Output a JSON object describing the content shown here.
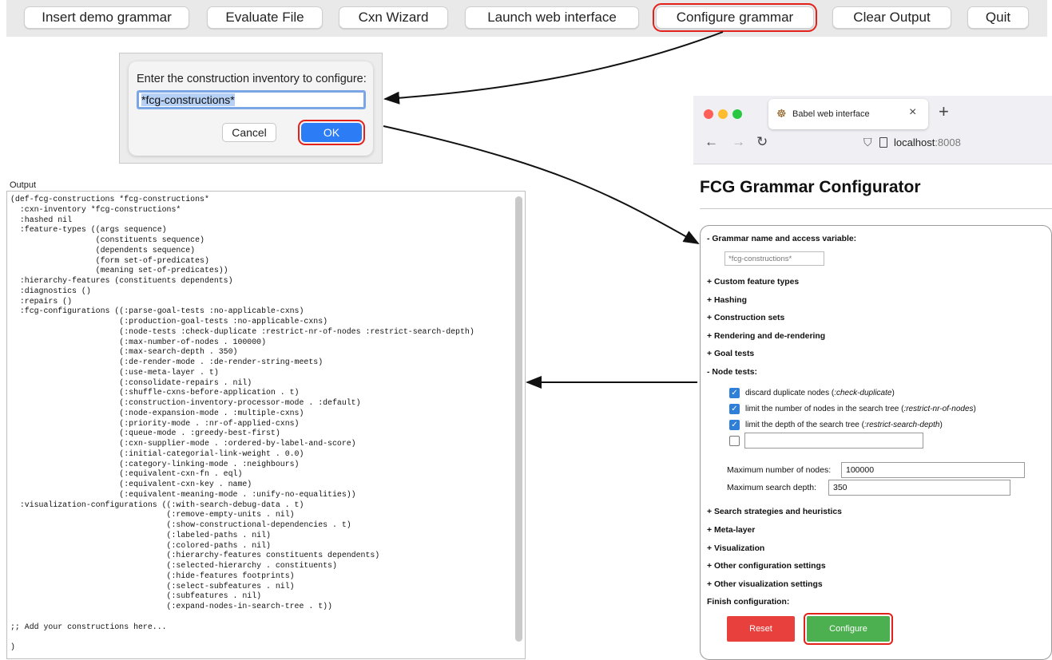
{
  "toolbar": {
    "insert_demo": "Insert demo grammar",
    "evaluate_file": "Evaluate File",
    "cxn_wizard": "Cxn Wizard",
    "launch_web": "Launch web interface",
    "configure": "Configure grammar",
    "clear_output": "Clear Output",
    "quit": "Quit"
  },
  "dialog": {
    "prompt": "Enter the construction inventory to configure:",
    "value": "*fcg-constructions*",
    "cancel": "Cancel",
    "ok": "OK"
  },
  "output": {
    "title": "Output",
    "lines": [
      "(def-fcg-constructions *fcg-constructions*",
      "  :cxn-inventory *fcg-constructions*",
      "  :hashed nil",
      "  :feature-types ((args sequence)",
      "                  (constituents sequence)",
      "                  (dependents sequence)",
      "                  (form set-of-predicates)",
      "                  (meaning set-of-predicates))",
      "  :hierarchy-features (constituents dependents)",
      "  :diagnostics ()",
      "  :repairs ()",
      "  :fcg-configurations ((:parse-goal-tests :no-applicable-cxns)",
      "                       (:production-goal-tests :no-applicable-cxns)",
      "                       (:node-tests :check-duplicate :restrict-nr-of-nodes :restrict-search-depth)",
      "                       (:max-number-of-nodes . 100000)",
      "                       (:max-search-depth . 350)",
      "                       (:de-render-mode . :de-render-string-meets)",
      "                       (:use-meta-layer . t)",
      "                       (:consolidate-repairs . nil)",
      "                       (:shuffle-cxns-before-application . t)",
      "                       (:construction-inventory-processor-mode . :default)",
      "                       (:node-expansion-mode . :multiple-cxns)",
      "                       (:priority-mode . :nr-of-applied-cxns)",
      "                       (:queue-mode . :greedy-best-first)",
      "                       (:cxn-supplier-mode . :ordered-by-label-and-score)",
      "                       (:initial-categorial-link-weight . 0.0)",
      "                       (:category-linking-mode . :neighbours)",
      "                       (:equivalent-cxn-fn . eql)",
      "                       (:equivalent-cxn-key . name)",
      "                       (:equivalent-meaning-mode . :unify-no-equalities))",
      "  :visualization-configurations ((:with-search-debug-data . t)",
      "                                 (:remove-empty-units . nil)",
      "                                 (:show-constructional-dependencies . t)",
      "                                 (:labeled-paths . nil)",
      "                                 (:colored-paths . nil)",
      "                                 (:hierarchy-features constituents dependents)",
      "                                 (:selected-hierarchy . constituents)",
      "                                 (:hide-features footprints)",
      "                                 (:select-subfeatures . nil)",
      "                                 (:subfeatures . nil)",
      "                                 (:expand-nodes-in-search-tree . t))",
      "",
      ";; Add your constructions here...",
      "",
      ")"
    ]
  },
  "browser": {
    "tab_title": "Babel web interface",
    "tab_close": "×",
    "new_tab": "+",
    "back": "←",
    "forward": "→",
    "reload": "↻",
    "shield": "⛉",
    "url_host": "localhost",
    "url_port": ":8008",
    "traffic_colors": [
      "#ff5f57",
      "#febc2e",
      "#28c840"
    ]
  },
  "configurator": {
    "page_title": "FCG Grammar Configurator",
    "section_name": "- Grammar name and access variable:",
    "name_placeholder": "*fcg-constructions*",
    "sections_top": [
      "+ Custom feature types",
      "+ Hashing",
      "+ Construction sets",
      "+ Rendering and de-rendering",
      "+ Goal tests"
    ],
    "node_tests_heading": "- Node tests:",
    "node_tests": [
      {
        "text": "discard duplicate nodes (",
        "code": ":check-duplicate",
        "end": ")",
        "checked": true
      },
      {
        "text": "limit the number of nodes in the search tree (",
        "code": ":restrict-nr-of-nodes",
        "end": ")",
        "checked": true
      },
      {
        "text": "limit the depth of the search tree (",
        "code": ":restrict-search-depth",
        "end": ")",
        "checked": true
      }
    ],
    "max_nodes_label": "Maximum number of nodes:",
    "max_nodes_value": "100000",
    "max_depth_label": "Maximum search depth:",
    "max_depth_value": "350",
    "sections_bottom": [
      "+ Search strategies and heuristics",
      "+ Meta-layer",
      "+ Visualization",
      "+ Other configuration settings",
      "+ Other visualization settings"
    ],
    "finish_heading": "Finish configuration:",
    "reset": "Reset",
    "configure": "Configure"
  },
  "colors": {
    "highlight": "#e3211b",
    "ok_blue": "#2c7cf6",
    "reset_red": "#e8413d",
    "configure_green": "#4caf50",
    "checkbox_blue": "#2f7fd9"
  }
}
